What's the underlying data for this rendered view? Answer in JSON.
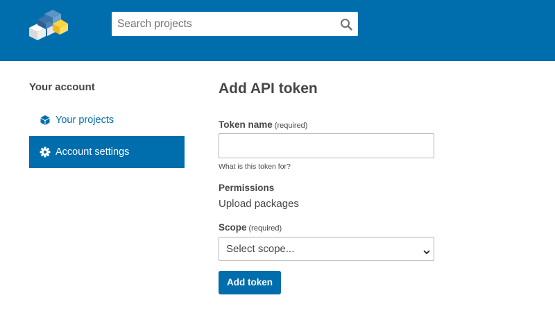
{
  "header": {
    "logo_icon": "pypi-cubes-logo",
    "search": {
      "placeholder": "Search projects",
      "icon": "search-icon"
    },
    "colors": {
      "brand": "#006dad"
    }
  },
  "sidebar": {
    "title": "Your account",
    "items": [
      {
        "label": "Your projects",
        "icon": "cube-icon",
        "active": false
      },
      {
        "label": "Account settings",
        "icon": "gear-icon",
        "active": true
      }
    ]
  },
  "form": {
    "title": "Add API token",
    "token_name": {
      "label": "Token name",
      "required_text": "(required)",
      "value": "",
      "help": "What is this token for?"
    },
    "permissions": {
      "label": "Permissions",
      "value": "Upload packages"
    },
    "scope": {
      "label": "Scope",
      "required_text": "(required)",
      "selected": "Select scope..."
    },
    "submit_label": "Add token"
  }
}
